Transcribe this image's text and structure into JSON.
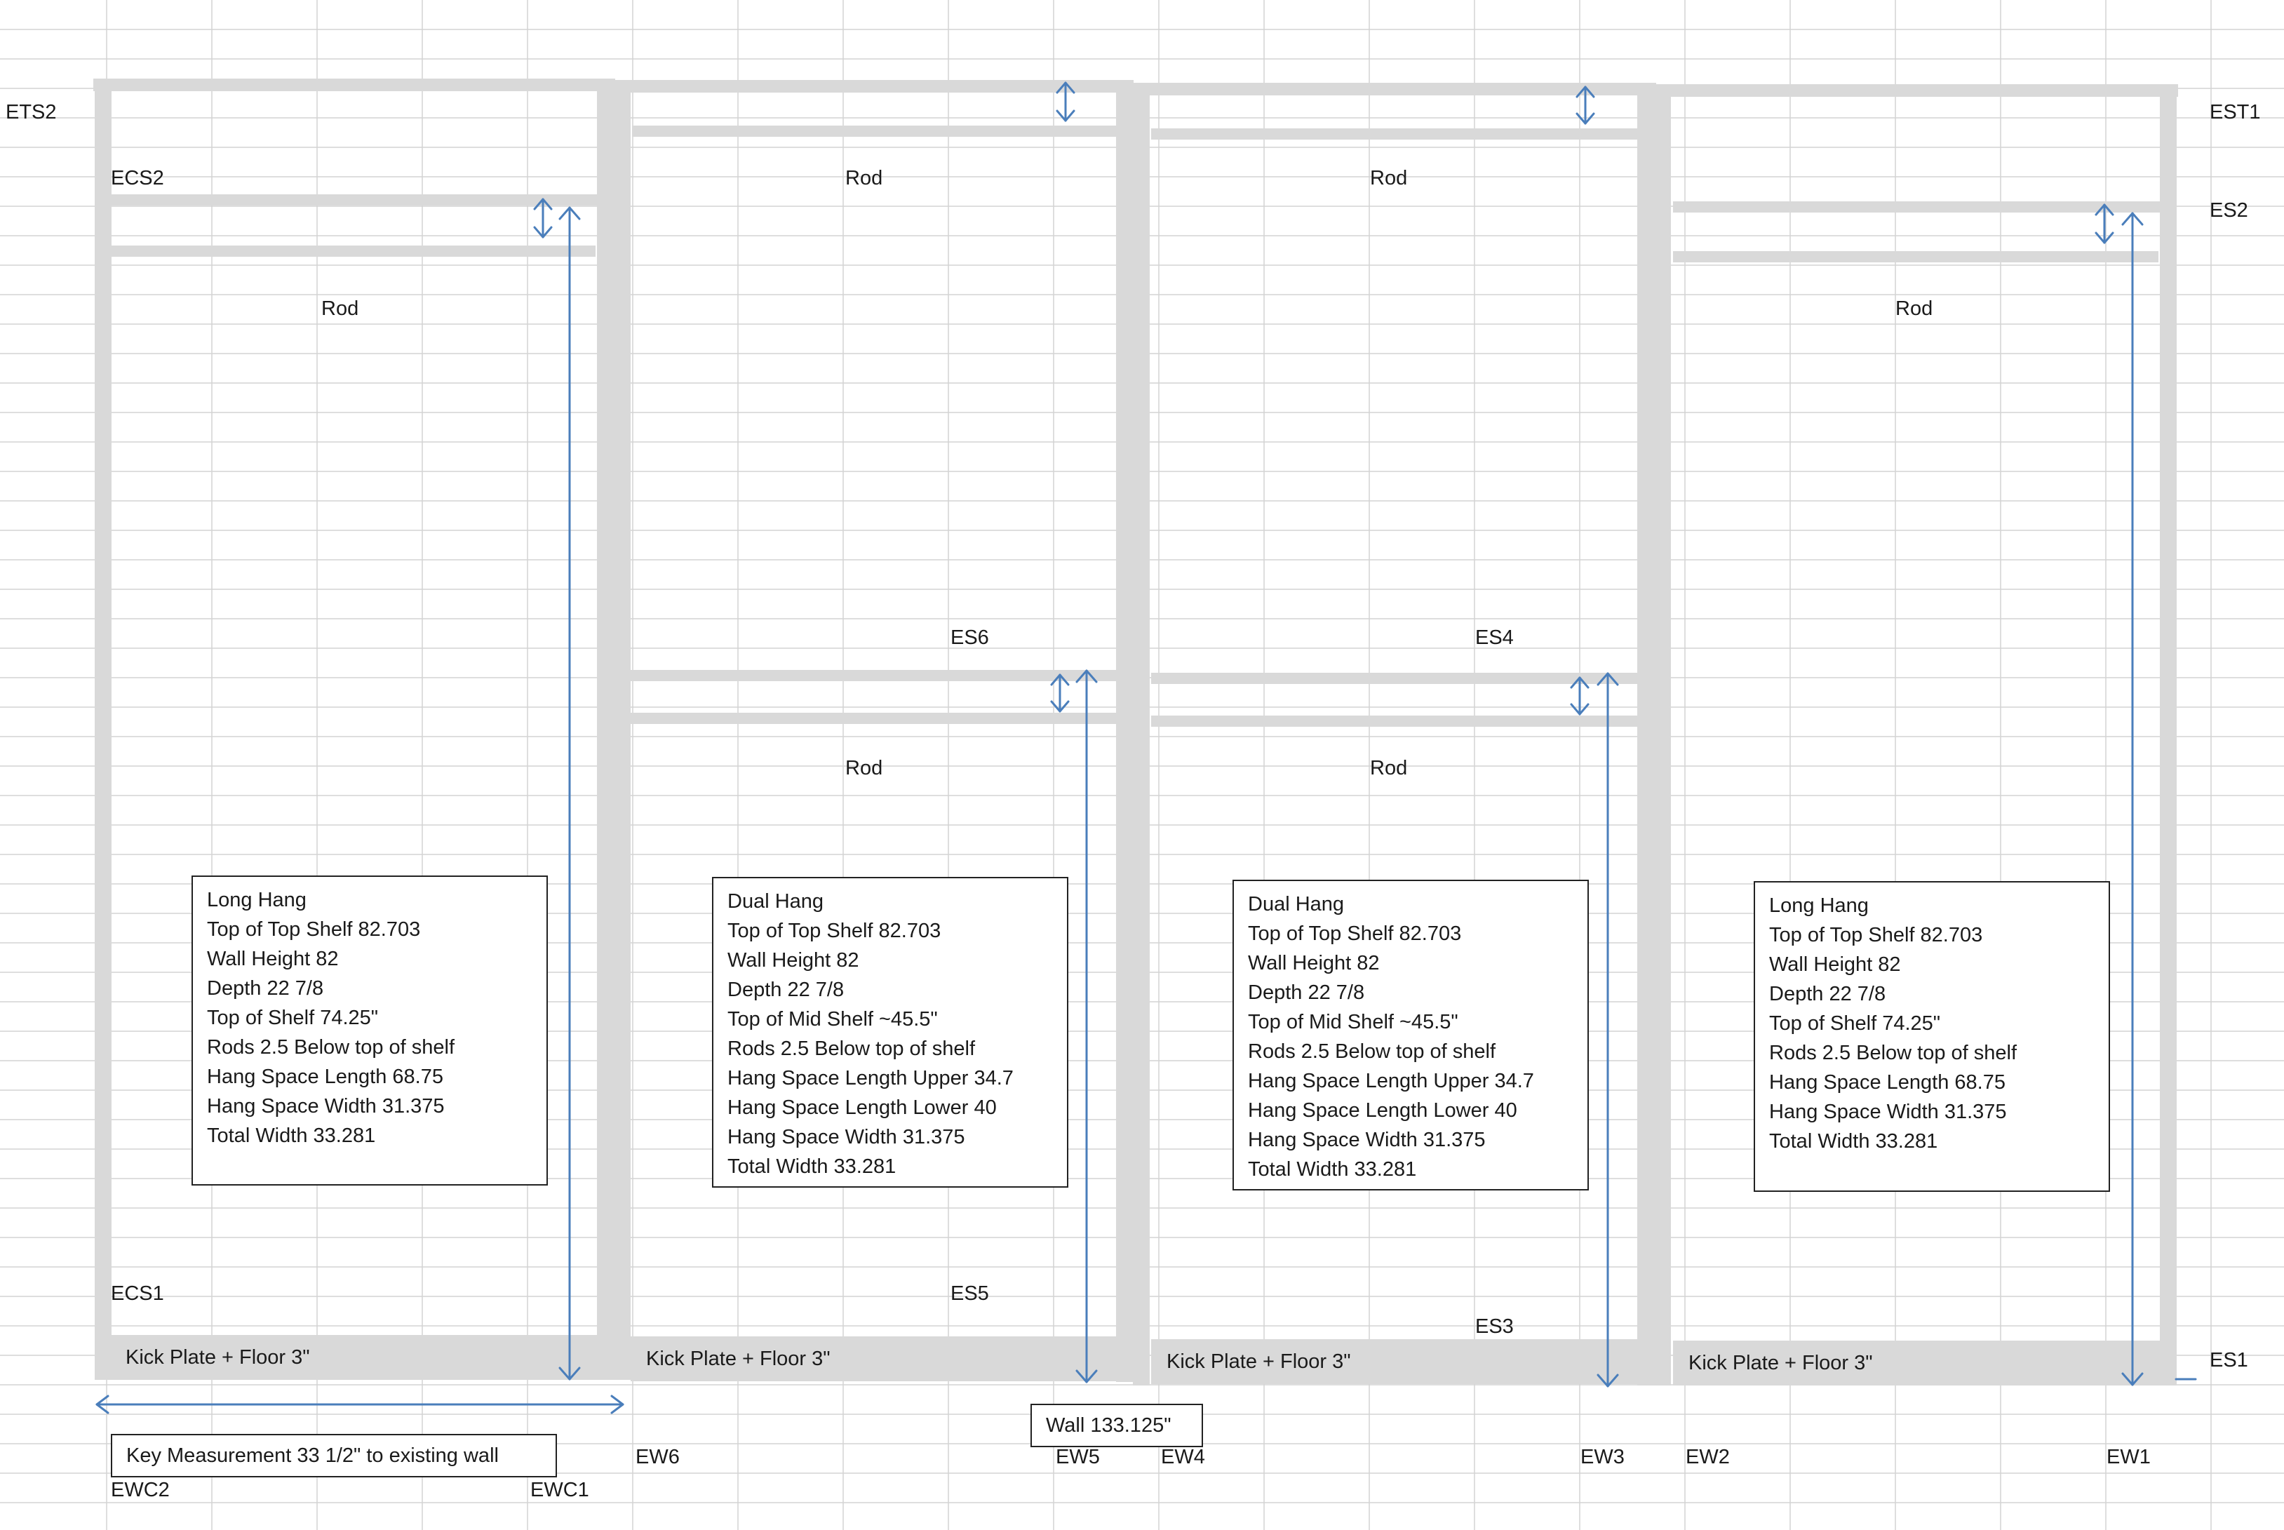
{
  "corner_labels": {
    "ets2": "ETS2",
    "est1": "EST1",
    "es2": "ES2",
    "es1": "ES1",
    "ecs2": "ECS2",
    "ecs1": "ECS1",
    "es6": "ES6",
    "es5": "ES5",
    "es4": "ES4",
    "es3": "ES3"
  },
  "rod_label": "Rod",
  "kick_plate_label": "Kick Plate + Floor 3\"",
  "bottom_labels": {
    "ewc2": "EWC2",
    "ewc1": "EWC1",
    "ew6": "EW6",
    "ew5": "EW5",
    "ew4": "EW4",
    "ew3": "EW3",
    "ew2": "EW2",
    "ew1": "EW1"
  },
  "key_measurement": "Key Measurement 33 1/2\" to existing wall",
  "wall_measurement": "Wall 133.125\"",
  "notes": [
    {
      "lines": [
        "Long Hang",
        "Top of Top Shelf 82.703",
        "Wall Height 82",
        "Depth 22 7/8",
        "Top of  Shelf  74.25\"",
        "Rods 2.5 Below top of shelf",
        "Hang Space Length 68.75",
        "Hang Space Width 31.375",
        "Total Width 33.281"
      ]
    },
    {
      "lines": [
        "Dual Hang",
        "Top of Top Shelf 82.703",
        "Wall Height 82",
        "Depth 22 7/8",
        "Top of  Mid Shelf ~45.5\"",
        "Rods 2.5 Below top of shelf",
        "Hang Space Length Upper 34.7",
        "Hang Space Length Lower 40",
        "Hang Space Width 31.375",
        "Total Width 33.281"
      ]
    },
    {
      "lines": [
        "Dual Hang",
        "Top of Top Shelf 82.703",
        "Wall Height 82",
        "Depth 22 7/8",
        "Top of  Mid Shelf ~45.5\"",
        "Rods 2.5 Below top of shelf",
        "Hang Space Length Upper 34.7",
        "Hang Space Length Lower 40",
        "Hang Space Width 31.375",
        "Total Width 33.281"
      ]
    },
    {
      "lines": [
        "Long Hang",
        "Top of Top Shelf 82.703",
        "Wall Height 82",
        "Depth 22 7/8",
        "Top of  Shelf  74.25\"",
        "Rods 2.5 Below top of shelf",
        "Hang Space Length 68.75",
        "Hang Space Width 31.375",
        "Total Width 33.281"
      ]
    }
  ],
  "colors": {
    "panel": "#d9d9d9",
    "gridline": "#d4d4d4",
    "dimension_arrow": "#4a7ebb",
    "text": "#1a1a1a"
  }
}
